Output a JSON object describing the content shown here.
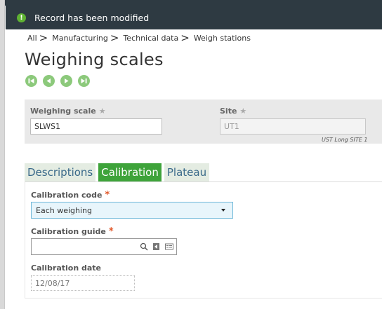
{
  "notification": {
    "text": "Record has been modified",
    "icon": "alert-icon",
    "icon_glyph": "!",
    "bg_color": "#2e3a42",
    "icon_color": "#5fb232"
  },
  "breadcrumb": {
    "items": [
      "All",
      "Manufacturing",
      "Technical data",
      "Weigh stations"
    ],
    "separator": ">"
  },
  "page": {
    "title": "Weighing scales"
  },
  "record_nav": {
    "buttons": [
      "first-record-button",
      "previous-record-button",
      "next-record-button",
      "last-record-button"
    ]
  },
  "header": {
    "weighing_scale": {
      "label": "Weighing scale",
      "star": "★",
      "value": "SLWS1"
    },
    "site": {
      "label": "Site",
      "star": "★",
      "value": "UT1",
      "description": "UST Long SITE 1"
    }
  },
  "tabs": {
    "items": [
      {
        "label": "Descriptions",
        "active": false
      },
      {
        "label": "Calibration",
        "active": true
      },
      {
        "label": "Plateau",
        "active": false
      }
    ],
    "active_color": "#3ea33a"
  },
  "calibration": {
    "code": {
      "label": "Calibration code",
      "required": "*",
      "value": "Each weighing"
    },
    "guide": {
      "label": "Calibration guide",
      "required": "*",
      "value": ""
    },
    "date": {
      "label": "Calibration date",
      "value": "12/08/17"
    }
  }
}
